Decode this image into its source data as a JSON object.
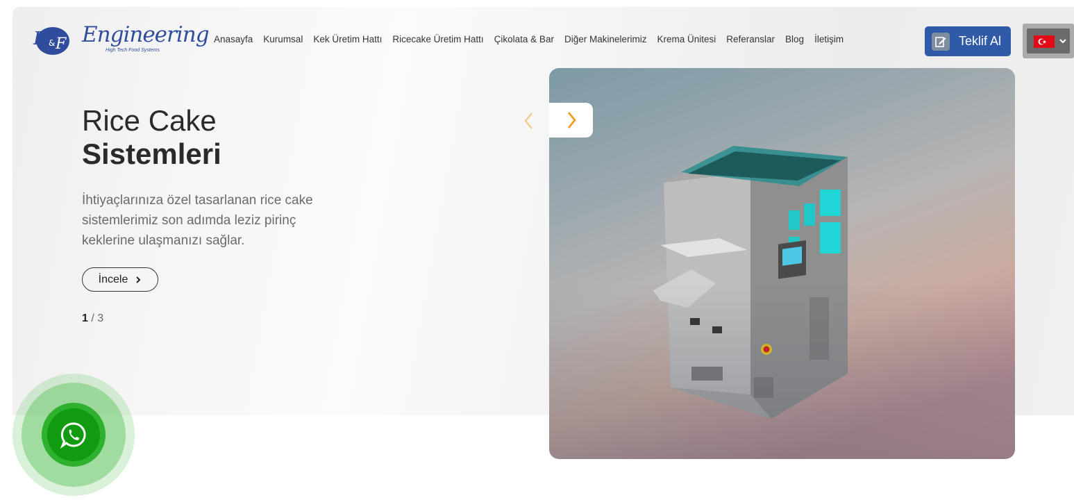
{
  "brand": {
    "logo_text": "Engineering",
    "logo_mark": "B&F",
    "tagline": "High Tech Food Systems"
  },
  "nav": {
    "items": [
      {
        "label": "Anasayfa"
      },
      {
        "label": "Kurumsal"
      },
      {
        "label": "Kek Üretim Hattı"
      },
      {
        "label": "Ricecake Üretim Hattı"
      },
      {
        "label": "Çikolata & Bar"
      },
      {
        "label": "Diğer Makinelerimiz"
      },
      {
        "label": "Krema Ünitesi"
      },
      {
        "label": "Referanslar"
      },
      {
        "label": "Blog"
      },
      {
        "label": "İletişim"
      }
    ],
    "cta_label": "Teklif Al",
    "cta_icon": "edit-document-icon",
    "language": "tr",
    "language_icon": "turkey-flag-icon"
  },
  "hero": {
    "title_light": "Rice Cake",
    "title_bold": "Sistemleri",
    "description": "İhtiyaçlarınıza özel tasarlanan rice cake sistemlerimiz son adımda leziz pirinç keklerine ulaşmanızı sağlar.",
    "button_label": "İncele",
    "slide_current": "1",
    "slide_separator": " / 3"
  },
  "colors": {
    "primary": "#2e5aa8",
    "arrow": "#f0a020",
    "whatsapp": "#109b10"
  },
  "floating": {
    "whatsapp_icon": "whatsapp-icon"
  }
}
